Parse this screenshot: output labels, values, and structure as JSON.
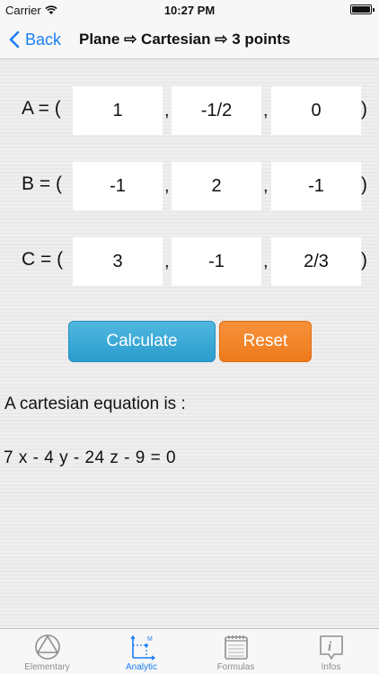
{
  "status": {
    "carrier": "Carrier",
    "time": "10:27 PM"
  },
  "nav": {
    "back_label": "Back",
    "title": "Plane ⇨ Cartesian ⇨ 3 points"
  },
  "points": [
    {
      "label": "A = (",
      "x": "1",
      "y": "-1/2",
      "z": "0"
    },
    {
      "label": "B = (",
      "x": "-1",
      "y": "2",
      "z": "-1"
    },
    {
      "label": "C = (",
      "x": "3",
      "y": "-1",
      "z": "2/3"
    }
  ],
  "separator": ",",
  "close_paren": ")",
  "buttons": {
    "calculate": "Calculate",
    "reset": "Reset"
  },
  "result": {
    "label": "A cartesian equation is :",
    "equation": "7 x - 4 y - 24 z - 9 = 0"
  },
  "tabs": [
    {
      "label": "Elementary",
      "icon": "triangle-circle-icon"
    },
    {
      "label": "Analytic",
      "icon": "axes-icon",
      "active": true
    },
    {
      "label": "Formulas",
      "icon": "notepad-icon"
    },
    {
      "label": "Infos",
      "icon": "info-icon"
    }
  ],
  "colors": {
    "accent": "#1a7ef5",
    "calculate": "#2a9ccd",
    "reset": "#ee7a1c"
  }
}
